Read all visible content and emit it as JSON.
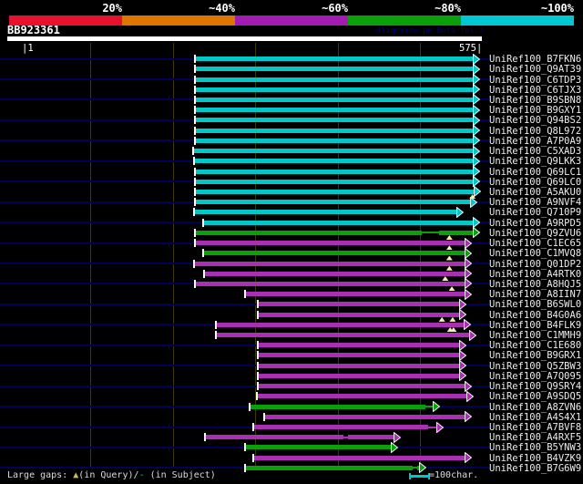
{
  "header": {
    "title": "BB923361",
    "watermark": "AlignView.pm Beta rel.7",
    "scale": [
      {
        "label": "20%",
        "color": "#e8112d"
      },
      {
        "label": "~40%",
        "color": "#dd7500"
      },
      {
        "label": "~60%",
        "color": "#a21cb4"
      },
      {
        "label": "~80%",
        "color": "#0aa00a"
      },
      {
        "label": "~100%",
        "color": "#00c8d2"
      }
    ]
  },
  "ruler": {
    "start_label": "|1",
    "end_label": "575|"
  },
  "footer": {
    "gaps_prefix": "Large gaps: ",
    "gaps_query_marker": "▲",
    "gaps_mid": "(in Query)/",
    "gaps_subject_marker": "-",
    "gaps_suffix": " (in Subject)",
    "scale_legend": "=100char."
  },
  "colors": {
    "background": "#000000",
    "query_bar": "#ffffff",
    "gridline": "#3b3a00",
    "row_baseline": "#000058",
    "gap_triangle": "#f5f0b0",
    "buckets": {
      "~100%": "#00c8c8",
      "~80%": "#0aa00a",
      "~60%": "#ab2fb5"
    }
  },
  "chart_data": {
    "type": "bar",
    "subtype": "sequence-alignment-overview",
    "title": "BB923361",
    "xlabel": "query position (characters)",
    "x_axis": {
      "min": 1,
      "max": 575,
      "gridline_interval": 100,
      "gridlines": [
        100,
        200,
        300,
        400,
        500
      ]
    },
    "legend_position": "top",
    "legend_buckets": [
      "20%",
      "~40%",
      "~60%",
      "~80%",
      "~100%"
    ],
    "rows": [
      {
        "id": "UniRef100_B7FKN6",
        "bucket": "~100%",
        "start": 227,
        "end": 573,
        "query_gaps": [],
        "subject_gaps": []
      },
      {
        "id": "UniRef100_Q9AT39",
        "bucket": "~100%",
        "start": 227,
        "end": 573,
        "query_gaps": [],
        "subject_gaps": []
      },
      {
        "id": "UniRef100_C6TDP3",
        "bucket": "~100%",
        "start": 227,
        "end": 573,
        "query_gaps": [],
        "subject_gaps": []
      },
      {
        "id": "UniRef100_C6TJX3",
        "bucket": "~100%",
        "start": 227,
        "end": 573,
        "query_gaps": [],
        "subject_gaps": []
      },
      {
        "id": "UniRef100_B9SBN8",
        "bucket": "~100%",
        "start": 227,
        "end": 573,
        "query_gaps": [],
        "subject_gaps": []
      },
      {
        "id": "UniRef100_B9GXY1",
        "bucket": "~100%",
        "start": 227,
        "end": 573,
        "query_gaps": [],
        "subject_gaps": []
      },
      {
        "id": "UniRef100_Q94BS2",
        "bucket": "~100%",
        "start": 227,
        "end": 573,
        "query_gaps": [],
        "subject_gaps": []
      },
      {
        "id": "UniRef100_Q8L972",
        "bucket": "~100%",
        "start": 227,
        "end": 573,
        "query_gaps": [],
        "subject_gaps": []
      },
      {
        "id": "UniRef100_A7P0A9",
        "bucket": "~100%",
        "start": 227,
        "end": 573,
        "query_gaps": [],
        "subject_gaps": []
      },
      {
        "id": "UniRef100_C5XAD3",
        "bucket": "~100%",
        "start": 225,
        "end": 573,
        "query_gaps": [],
        "subject_gaps": []
      },
      {
        "id": "UniRef100_Q9LKK3",
        "bucket": "~100%",
        "start": 226,
        "end": 573,
        "query_gaps": [],
        "subject_gaps": []
      },
      {
        "id": "UniRef100_Q69LC1",
        "bucket": "~100%",
        "start": 227,
        "end": 573,
        "query_gaps": [],
        "subject_gaps": []
      },
      {
        "id": "UniRef100_Q69LC0",
        "bucket": "~100%",
        "start": 227,
        "end": 573,
        "query_gaps": [],
        "subject_gaps": []
      },
      {
        "id": "UniRef100_A5AKU0",
        "bucket": "~100%",
        "start": 227,
        "end": 574,
        "query_gaps": [],
        "subject_gaps": []
      },
      {
        "id": "UniRef100_A9NVF4",
        "bucket": "~100%",
        "start": 227,
        "end": 569,
        "query_gaps": [
          563
        ],
        "subject_gaps": []
      },
      {
        "id": "UniRef100_Q710P9",
        "bucket": "~100%",
        "start": 226,
        "end": 553,
        "query_gaps": [],
        "subject_gaps": []
      },
      {
        "id": "UniRef100_A9RPD5",
        "bucket": "~100%",
        "start": 237,
        "end": 573,
        "query_gaps": [],
        "subject_gaps": []
      },
      {
        "id": "UniRef100_Q9ZVU6",
        "bucket": "~80%",
        "start": 227,
        "end": 573,
        "query_gaps": [],
        "subject_gaps": [
          [
            502,
            523
          ]
        ]
      },
      {
        "id": "UniRef100_C1EC65",
        "bucket": "~60%",
        "start": 227,
        "end": 563,
        "query_gaps": [
          535
        ],
        "subject_gaps": []
      },
      {
        "id": "UniRef100_C1MVQ8",
        "bucket": "~80%",
        "start": 237,
        "end": 563,
        "query_gaps": [
          535
        ],
        "subject_gaps": []
      },
      {
        "id": "UniRef100_Q01DP2",
        "bucket": "~60%",
        "start": 226,
        "end": 563,
        "query_gaps": [
          535
        ],
        "subject_gaps": []
      },
      {
        "id": "UniRef100_A4RTK0",
        "bucket": "~60%",
        "start": 238,
        "end": 563,
        "query_gaps": [
          535
        ],
        "subject_gaps": []
      },
      {
        "id": "UniRef100_A8HQJ5",
        "bucket": "~60%",
        "start": 227,
        "end": 563,
        "query_gaps": [
          530
        ],
        "subject_gaps": []
      },
      {
        "id": "UniRef100_A8IIN7",
        "bucket": "~60%",
        "start": 288,
        "end": 563,
        "query_gaps": [
          538
        ],
        "subject_gaps": []
      },
      {
        "id": "UniRef100_B6SWL0",
        "bucket": "~60%",
        "start": 303,
        "end": 556,
        "query_gaps": [],
        "subject_gaps": []
      },
      {
        "id": "UniRef100_B4G0A6",
        "bucket": "~60%",
        "start": 303,
        "end": 556,
        "query_gaps": [],
        "subject_gaps": []
      },
      {
        "id": "UniRef100_B4FLK9",
        "bucket": "~60%",
        "start": 252,
        "end": 562,
        "query_gaps": [
          526,
          539
        ],
        "subject_gaps": []
      },
      {
        "id": "UniRef100_C1MMH9",
        "bucket": "~60%",
        "start": 252,
        "end": 568,
        "query_gaps": [
          536,
          540
        ],
        "subject_gaps": []
      },
      {
        "id": "UniRef100_C1E680",
        "bucket": "~60%",
        "start": 303,
        "end": 556,
        "query_gaps": [],
        "subject_gaps": []
      },
      {
        "id": "UniRef100_B9GRX1",
        "bucket": "~60%",
        "start": 303,
        "end": 556,
        "query_gaps": [],
        "subject_gaps": []
      },
      {
        "id": "UniRef100_Q5ZBW3",
        "bucket": "~60%",
        "start": 303,
        "end": 556,
        "query_gaps": [],
        "subject_gaps": []
      },
      {
        "id": "UniRef100_A7Q095",
        "bucket": "~60%",
        "start": 303,
        "end": 556,
        "query_gaps": [],
        "subject_gaps": []
      },
      {
        "id": "UniRef100_Q9SRY4",
        "bucket": "~60%",
        "start": 303,
        "end": 563,
        "query_gaps": [],
        "subject_gaps": []
      },
      {
        "id": "UniRef100_A9SDQ5",
        "bucket": "~60%",
        "start": 302,
        "end": 565,
        "query_gaps": [],
        "subject_gaps": []
      },
      {
        "id": "UniRef100_A8ZVN6",
        "bucket": "~80%",
        "start": 293,
        "end": 524,
        "query_gaps": [],
        "subject_gaps": [
          [
            506,
            519
          ]
        ]
      },
      {
        "id": "UniRef100_A4S4X1",
        "bucket": "~60%",
        "start": 311,
        "end": 563,
        "query_gaps": [],
        "subject_gaps": []
      },
      {
        "id": "UniRef100_A7BVF8",
        "bucket": "~60%",
        "start": 298,
        "end": 529,
        "query_gaps": [],
        "subject_gaps": [
          [
            510,
            524
          ]
        ]
      },
      {
        "id": "UniRef100_A4RXF5",
        "bucket": "~60%",
        "start": 239,
        "end": 477,
        "query_gaps": [],
        "subject_gaps": [
          [
            407,
            413
          ]
        ]
      },
      {
        "id": "UniRef100_B5YNW3",
        "bucket": "~80%",
        "start": 288,
        "end": 473,
        "query_gaps": [],
        "subject_gaps": []
      },
      {
        "id": "UniRef100_B4VZK9",
        "bucket": "~60%",
        "start": 298,
        "end": 563,
        "query_gaps": [],
        "subject_gaps": []
      },
      {
        "id": "UniRef100_B7G6W9",
        "bucket": "~80%",
        "start": 288,
        "end": 508,
        "query_gaps": [],
        "subject_gaps": [
          [
            491,
            497
          ]
        ]
      }
    ]
  }
}
